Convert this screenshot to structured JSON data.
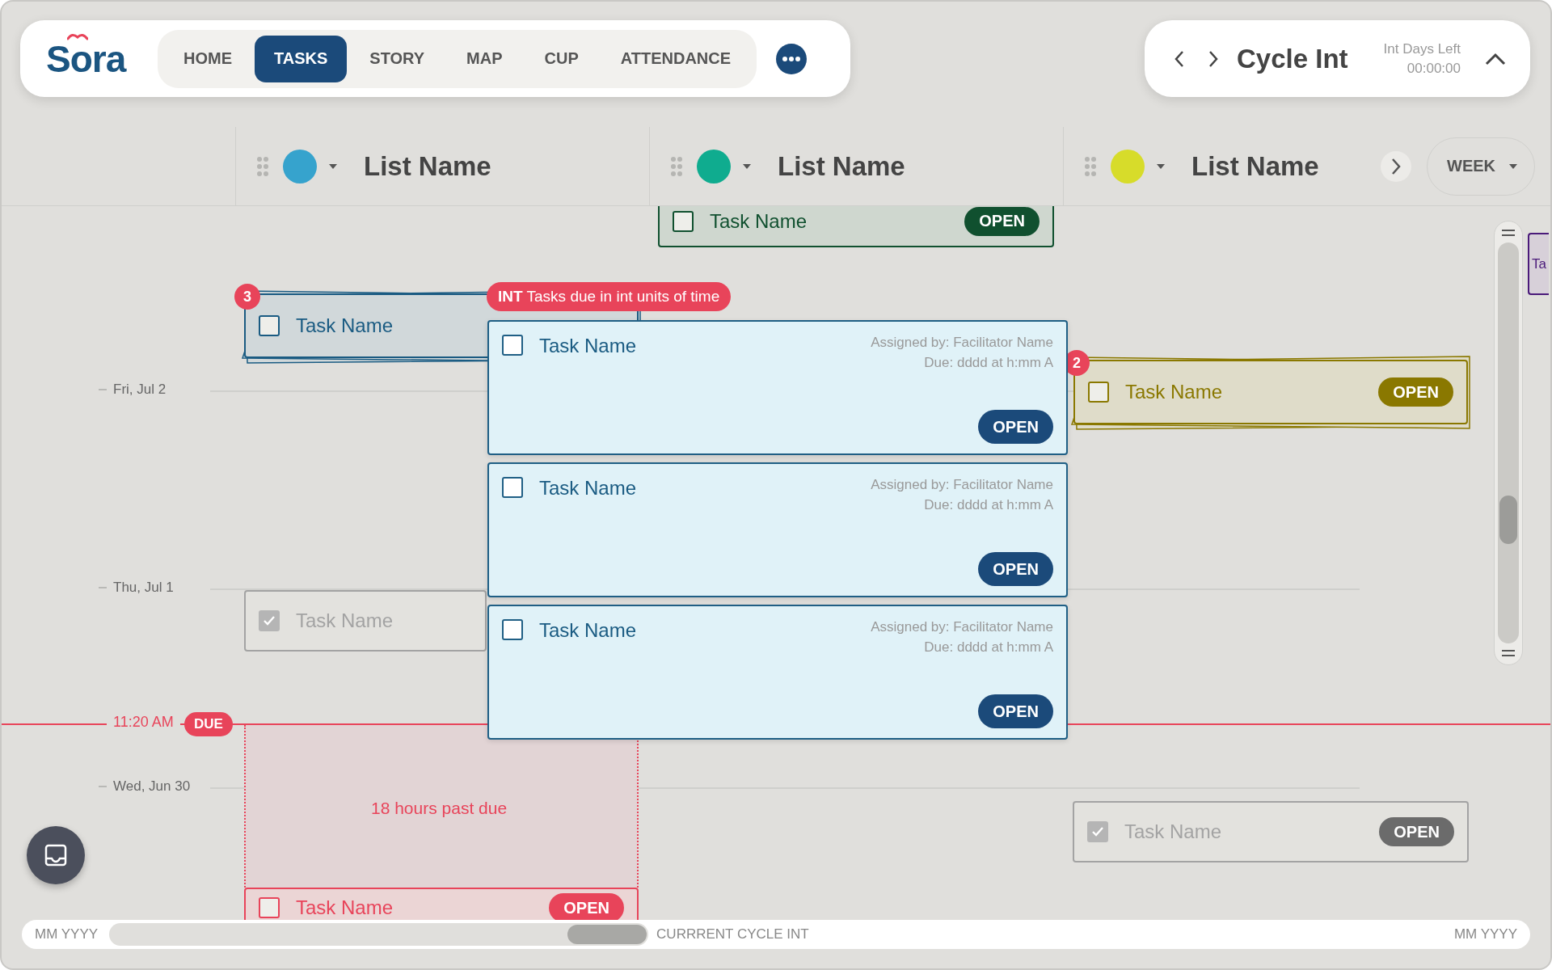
{
  "nav": {
    "logo": "Sora",
    "tabs": [
      {
        "label": "HOME",
        "selected": false
      },
      {
        "label": "TASKS",
        "selected": true
      },
      {
        "label": "STORY",
        "selected": false
      },
      {
        "label": "MAP",
        "selected": false
      },
      {
        "label": "CUP",
        "selected": false
      },
      {
        "label": "ATTENDANCE",
        "selected": false
      }
    ]
  },
  "cycle": {
    "title": "Cycle Int",
    "days_left_label": "Int Days Left",
    "countdown": "00:00:00"
  },
  "lists": [
    {
      "name": "List Name",
      "color": "#36a3cd"
    },
    {
      "name": "List Name",
      "color": "#0fac8f"
    },
    {
      "name": "List Name",
      "color": "#d7dc2a"
    }
  ],
  "view": {
    "label": "WEEK"
  },
  "timeline": {
    "days": [
      {
        "label": "Fri, Jul 2"
      },
      {
        "label": "Thu, Jul 1"
      },
      {
        "label": "Wed, Jun 30"
      }
    ],
    "now": {
      "time": "11:20 AM",
      "badge": "DUE"
    },
    "overdue": {
      "label": "18 hours past due"
    }
  },
  "cards": [
    {
      "kind": "card",
      "color": "#10502f",
      "title": "Task Name",
      "checked": false,
      "button": "OPEN"
    },
    {
      "kind": "stack",
      "color": "#1a5b82",
      "title": "Task Name",
      "checked": false,
      "count": "3"
    },
    {
      "kind": "stack",
      "color": "#8a7800",
      "title": "Task Name",
      "checked": false,
      "button": "OPEN",
      "count": "2"
    },
    {
      "kind": "sliver",
      "color": "#4a1a7a",
      "title": "Ta"
    },
    {
      "kind": "card",
      "color": "#a3a3a3",
      "title": "Task Name",
      "checked": true
    },
    {
      "kind": "card",
      "color": "#a3a3a3",
      "title": "Task Name",
      "checked": true,
      "button": "OPEN"
    },
    {
      "kind": "card",
      "color": "#e8445a",
      "title": "Task Name",
      "checked": false,
      "button": "OPEN"
    }
  ],
  "popup": {
    "tooltip": "**INT** Tasks due in int units of time",
    "items": [
      {
        "title": "Task Name",
        "checked": false,
        "assigned": "Assigned by: Facilitator Name",
        "due": "Due: dddd at h:mm A",
        "button": "OPEN"
      },
      {
        "title": "Task Name",
        "checked": false,
        "assigned": "Assigned by: Facilitator Name",
        "due": "Due: dddd at h:mm A",
        "button": "OPEN"
      },
      {
        "title": "Task Name",
        "checked": false,
        "assigned": "Assigned by: Facilitator Name",
        "due": "Due: dddd at h:mm A",
        "button": "OPEN"
      }
    ]
  },
  "range": {
    "start": "MM YYYY",
    "current": "CURRRENT CYCLE INT",
    "end": "MM YYYY"
  }
}
